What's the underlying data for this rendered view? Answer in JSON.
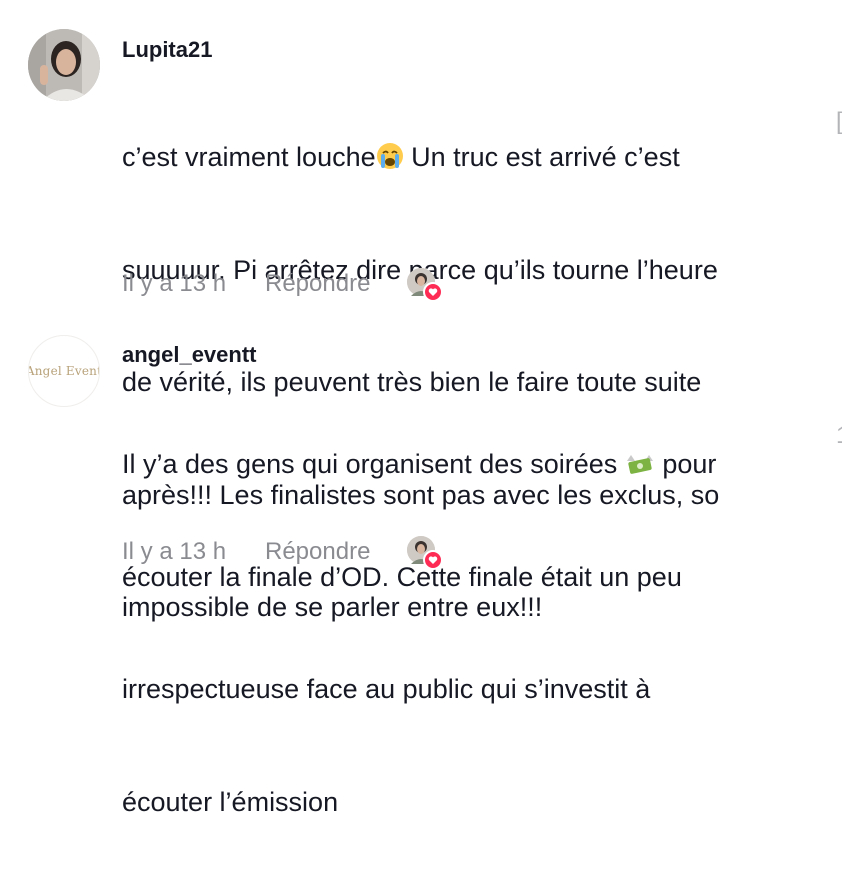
{
  "comments": [
    {
      "username": "Lupita21",
      "lines": [
        "c’est vraiment louche",
        " Un truc est arrivé c’est",
        "suuuuur. Pi arrêtez dire parce qu’ils tourne l’heure",
        "de vérité, ils peuvent très bien le faire toute suite",
        "après!!! Les finalistes sont pas avec les exclus, so",
        "impossible de se parler entre eux!!!"
      ],
      "emoji": "crying-face-emoji",
      "time": "Il y a 13 h",
      "reply_label": "Répondre",
      "avatar": "profile-photo",
      "liked_by_creator": true
    },
    {
      "username": "angel_eventt",
      "avatar_text": "Angel Event",
      "lines": [
        "Il y’a des gens qui organisent des soirées",
        " pour",
        "écouter la finale d’OD. Cette finale était un peu",
        "irrespectueuse face au public qui s’investit à",
        "écouter l’émission"
      ],
      "emoji": "money-with-wings-emoji",
      "time": "Il y a 13 h",
      "reply_label": "Répondre",
      "liked_by_creator": true
    }
  ],
  "side_glyphs": [
    "[",
    "1"
  ],
  "colors": {
    "text": "#161823",
    "meta": "#8a8b91",
    "heart": "#fe2c55"
  }
}
